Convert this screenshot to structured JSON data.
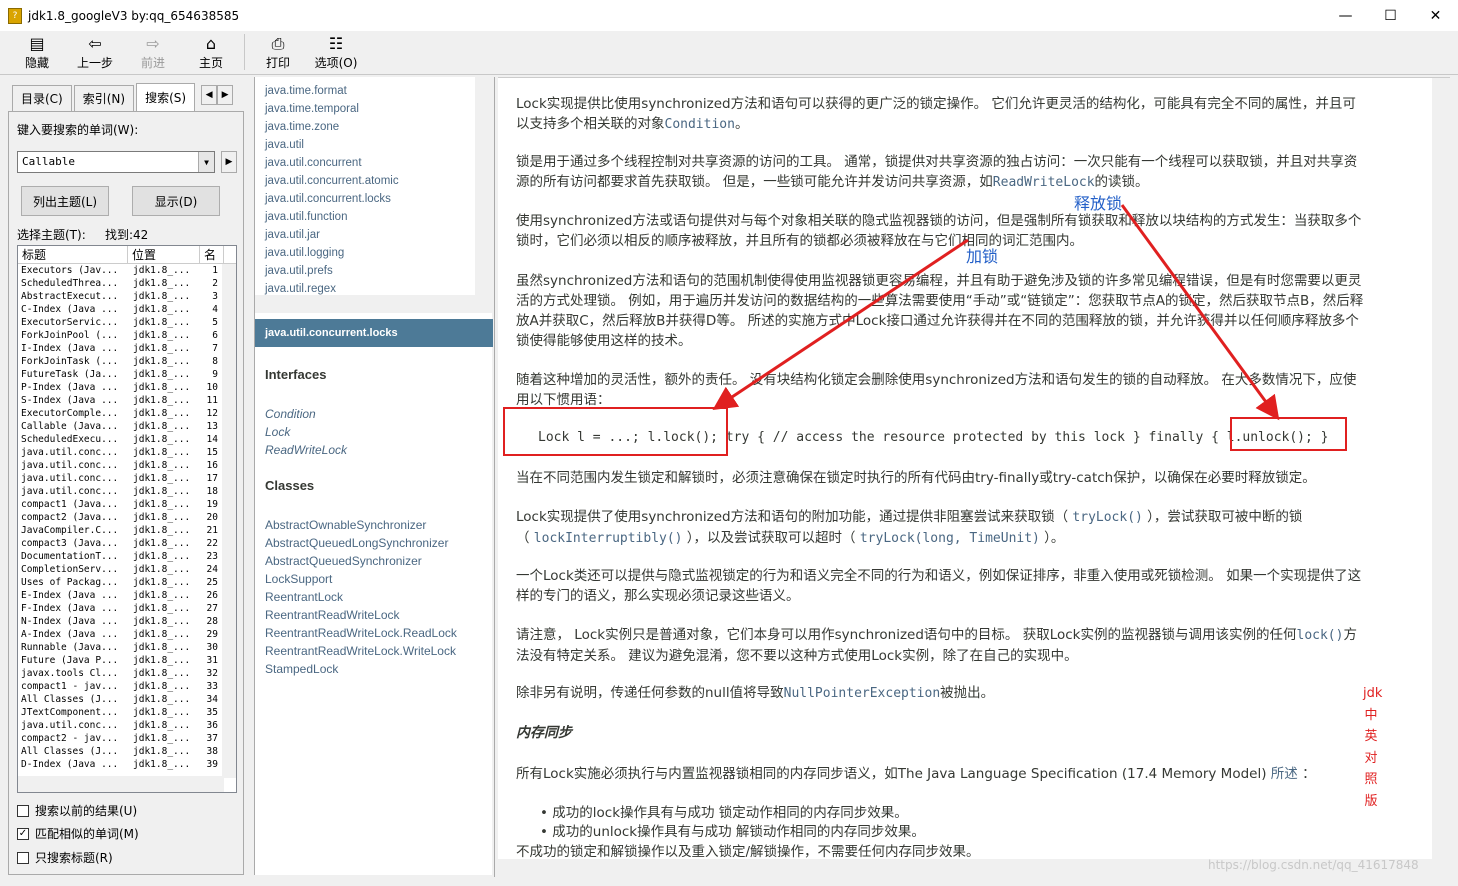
{
  "window": {
    "title": "jdk1.8_googleV3 by:qq_654638585"
  },
  "toolbar": {
    "hide": "隐藏",
    "back": "上一步",
    "forward": "前进",
    "home": "主页",
    "print": "打印",
    "options": "选项(O)"
  },
  "left": {
    "tabs": [
      "目录(C)",
      "索引(N)",
      "搜索(S)"
    ],
    "search_label": "键入要搜索的单词(W):",
    "search_value": "Callable",
    "list_topics": "列出主题(L)",
    "display": "显示(D)",
    "select_topic": "选择主题(T):",
    "found": "找到:42",
    "columns": [
      "标题",
      "位置",
      "名"
    ],
    "results": [
      [
        "Executors (Jav...",
        "jdk1.8_...",
        "1"
      ],
      [
        "ScheduledThrea...",
        "jdk1.8_...",
        "2"
      ],
      [
        "AbstractExecut...",
        "jdk1.8_...",
        "3"
      ],
      [
        "C-Index (Java ...",
        "jdk1.8_...",
        "4"
      ],
      [
        "ExecutorServic...",
        "jdk1.8_...",
        "5"
      ],
      [
        "ForkJoinPool (...",
        "jdk1.8_...",
        "6"
      ],
      [
        "I-Index (Java ...",
        "jdk1.8_...",
        "7"
      ],
      [
        "ForkJoinTask (...",
        "jdk1.8_...",
        "8"
      ],
      [
        "FutureTask (Ja...",
        "jdk1.8_...",
        "9"
      ],
      [
        "P-Index (Java ...",
        "jdk1.8_...",
        "10"
      ],
      [
        "S-Index (Java ...",
        "jdk1.8_...",
        "11"
      ],
      [
        "ExecutorComple...",
        "jdk1.8_...",
        "12"
      ],
      [
        "Callable (Java...",
        "jdk1.8_...",
        "13"
      ],
      [
        "ScheduledExecu...",
        "jdk1.8_...",
        "14"
      ],
      [
        "java.util.conc...",
        "jdk1.8_...",
        "15"
      ],
      [
        "java.util.conc...",
        "jdk1.8_...",
        "16"
      ],
      [
        "java.util.conc...",
        "jdk1.8_...",
        "17"
      ],
      [
        "java.util.conc...",
        "jdk1.8_...",
        "18"
      ],
      [
        "compact1 (Java...",
        "jdk1.8_...",
        "19"
      ],
      [
        "compact2 (Java...",
        "jdk1.8_...",
        "20"
      ],
      [
        "JavaCompiler.C...",
        "jdk1.8_...",
        "21"
      ],
      [
        "compact3 (Java...",
        "jdk1.8_...",
        "22"
      ],
      [
        "DocumentationT...",
        "jdk1.8_...",
        "23"
      ],
      [
        "CompletionServ...",
        "jdk1.8_...",
        "24"
      ],
      [
        "Uses of Packag...",
        "jdk1.8_...",
        "25"
      ],
      [
        "E-Index (Java ...",
        "jdk1.8_...",
        "26"
      ],
      [
        "F-Index (Java ...",
        "jdk1.8_...",
        "27"
      ],
      [
        "N-Index (Java ...",
        "jdk1.8_...",
        "28"
      ],
      [
        "A-Index (Java ...",
        "jdk1.8_...",
        "29"
      ],
      [
        "Runnable (Java...",
        "jdk1.8_...",
        "30"
      ],
      [
        "Future (Java P...",
        "jdk1.8_...",
        "31"
      ],
      [
        "javax.tools Cl...",
        "jdk1.8_...",
        "32"
      ],
      [
        "compact1 - jav...",
        "jdk1.8_...",
        "33"
      ],
      [
        "All Classes (J...",
        "jdk1.8_...",
        "34"
      ],
      [
        "JTextComponent...",
        "jdk1.8_...",
        "35"
      ],
      [
        "java.util.conc...",
        "jdk1.8_...",
        "36"
      ],
      [
        "compact2 - jav...",
        "jdk1.8_...",
        "37"
      ],
      [
        "All Classes (J...",
        "jdk1.8_...",
        "38"
      ],
      [
        "D-Index (Java ...",
        "jdk1.8_...",
        "39"
      ]
    ],
    "chk_prev": "搜索以前的结果(U)",
    "chk_similar": "匹配相似的单词(M)",
    "chk_titles": "只搜索标题(R)"
  },
  "mid": {
    "packages": [
      "java.time.format",
      "java.time.temporal",
      "java.time.zone",
      "java.util",
      "java.util.concurrent",
      "java.util.concurrent.atomic",
      "java.util.concurrent.locks",
      "java.util.function",
      "java.util.jar",
      "java.util.logging",
      "java.util.prefs",
      "java.util.regex"
    ],
    "header": "java.util.concurrent.locks",
    "interfaces_title": "Interfaces",
    "interfaces": [
      "Condition",
      "Lock",
      "ReadWriteLock"
    ],
    "classes_title": "Classes",
    "classes": [
      "AbstractOwnableSynchronizer",
      "AbstractQueuedLongSynchronizer",
      "AbstractQueuedSynchronizer",
      "LockSupport",
      "ReentrantLock",
      "ReentrantReadWriteLock",
      "ReentrantReadWriteLock.ReadLock",
      "ReentrantReadWriteLock.WriteLock",
      "StampedLock"
    ]
  },
  "doc": {
    "p1a": "Lock实现提供比使用synchronized方法和语句可以获得的更广泛的锁定操作。 它们允许更灵活的结构化，可能具有完全不同的属性，并且可",
    "p1b_pre": "以支持多个相关联的对象",
    "p1b_link": "Condition",
    "p1b_post": "。",
    "p2a": "锁是用于通过多个线程控制对共享资源的访问的工具。 通常，锁提供对共享资源的独占访问：一次只能有一个线程可以获取锁，并且对共享资",
    "p2b_pre": "源的所有访问都要求首先获取锁。 但是，一些锁可能允许并发访问共享资源，如",
    "p2b_link": "ReadWriteLock",
    "p2b_post": "的读锁。",
    "p3a": "使用synchronized方法或语句提供对与每个对象相关联的隐式监视器锁的访问，但是强制所有锁获取和释放以块结构的方式发生：当获取多个",
    "p3b": "锁时，它们必须以相反的顺序被释放，并且所有的锁都必须被释放在与它们相同的词汇范围内。",
    "p4a": "虽然synchronized方法和语句的范围机制使得使用监视器锁更容易编程，并且有助于避免涉及锁的许多常见编程错误，但是有时您需要以更灵",
    "p4b": "活的方式处理锁。 例如，用于遍历并发访问的数据结构的一些算法需要使用“手动”或“链锁定”：您获取节点A的锁定，然后获取节点B，然后释",
    "p4c": "放A并获取C，然后释放B并获得D等。 所述的实施方式中Lock接口通过允许获得并在不同的范围释放的锁，并允许获得并以任何顺序释放多个",
    "p4d": "锁使得能够使用这样的技术。",
    "p5a": "随着这种增加的灵活性，额外的责任。 没有块结构化锁定会删除使用synchronized方法和语句发生的锁的自动释放。 在大多数情况下，应使",
    "p5b": "用以下惯用语：",
    "code": "Lock l = ...; l.lock(); try { // access the resource protected by this lock } finally { l.unlock(); }",
    "p6": "当在不同范围内发生锁定和解锁时，必须注意确保在锁定时执行的所有代码由try-finally或try-catch保护，以确保在必要时释放锁定。",
    "p7a": "Lock实现提供了使用synchronized方法和语句的附加功能，通过提供非阻塞尝试来获取锁（ ",
    "p7a_link": "tryLock()",
    "p7a_post": " ），尝试获取可被中断的锁",
    "p7b_pre": "（ ",
    "p7b_link1": "lockInterruptibly()",
    "p7b_mid": " ），以及尝试获取可以超时（ ",
    "p7b_link2": "tryLock(long, TimeUnit)",
    "p7b_post": " ）。",
    "p8a": "一个Lock类还可以提供与隐式监视锁定的行为和语义完全不同的行为和语义，例如保证排序，非重入使用或死锁检测。 如果一个实现提供了这",
    "p8b": "样的专门的语义，那么实现必须记录这些语义。",
    "p9a_pre": "请注意， Lock实例只是普通对象，它们本身可以用作synchronized语句中的目标。 获取Lock实例的监视器锁与调用该实例的任何",
    "p9a_link": "lock()",
    "p9a_post": "方",
    "p9b": "法没有特定关系。 建议为避免混淆，您不要以这种方式使用Lock实例，除了在自己的实现中。",
    "p10_pre": "除非另有说明，传递任何参数的null值将导致",
    "p10_link": "NullPointerException",
    "p10_post": "被抛出。",
    "h_mem": "内存同步",
    "p11_pre": "所有Lock实施必须执行与内置监视器锁相同的内存同步语义，如The Java Language Specification (17.4 Memory Model) ",
    "p11_link": "所述",
    "p11_post": " ：",
    "b1": "成功的lock操作具有与成功 锁定动作相同的内存同步效果。",
    "b2": "成功的unlock操作具有与成功 解锁动作相同的内存同步效果。",
    "p12": "不成功的锁定和解锁操作以及重入锁定/解锁操作，不需要任何内存同步效果。"
  },
  "annotations": {
    "lock": "加锁",
    "unlock": "释放锁",
    "side": [
      "jdk",
      "中",
      "英",
      "对",
      "照",
      "版"
    ],
    "watermark": "https://blog.csdn.net/qq_41617848"
  },
  "colors": {
    "annotation_red": "#e02020",
    "annotation_blue": "#2460c8",
    "link": "#4a6782",
    "header_bg": "#4d7a97"
  }
}
